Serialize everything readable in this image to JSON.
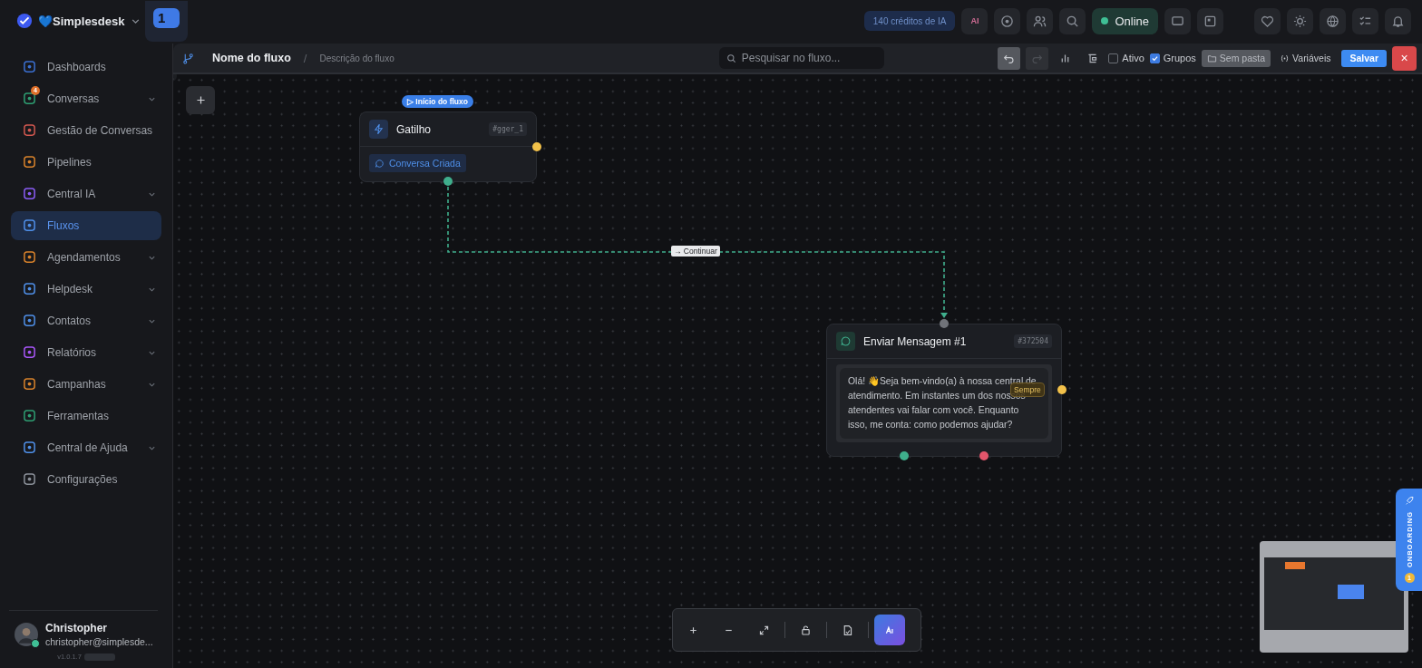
{
  "brand": {
    "name": "💙Simplesdesk"
  },
  "workspace": {
    "label": "1"
  },
  "topbar": {
    "credits": "140 créditos de IA",
    "ai": "AI",
    "status": "Online"
  },
  "sidebar": {
    "items": [
      {
        "label": "Dashboards",
        "color": "#3b6fd1",
        "expandable": false,
        "selected": false
      },
      {
        "label": "Conversas",
        "color": "#2e9e72",
        "expandable": true,
        "selected": false,
        "badge": "4"
      },
      {
        "label": "Gestão de Conversas",
        "color": "#d0574f",
        "expandable": false,
        "selected": false
      },
      {
        "label": "Pipelines",
        "color": "#d9822b",
        "expandable": false,
        "selected": false
      },
      {
        "label": "Central IA",
        "color": "#8b5cf6",
        "expandable": true,
        "selected": false
      },
      {
        "label": "Fluxos",
        "color": "#4f8fe8",
        "expandable": false,
        "selected": true
      },
      {
        "label": "Agendamentos",
        "color": "#d9822b",
        "expandable": true,
        "selected": false
      },
      {
        "label": "Helpdesk",
        "color": "#4f8fe8",
        "expandable": true,
        "selected": false
      },
      {
        "label": "Contatos",
        "color": "#4f8fe8",
        "expandable": true,
        "selected": false
      },
      {
        "label": "Relatórios",
        "color": "#a855f7",
        "expandable": true,
        "selected": false
      },
      {
        "label": "Campanhas",
        "color": "#d9822b",
        "expandable": true,
        "selected": false
      },
      {
        "label": "Ferramentas",
        "color": "#2e9e72",
        "expandable": false,
        "selected": false
      },
      {
        "label": "Central de Ajuda",
        "color": "#4f8fe8",
        "expandable": true,
        "selected": false
      },
      {
        "label": "Configurações",
        "color": "#8a8f98",
        "expandable": false,
        "selected": false
      }
    ]
  },
  "user": {
    "name": "Christopher",
    "email": "christopher@simplesde...",
    "online": true,
    "version": "v1.0.1.7"
  },
  "flow_toolbar": {
    "title": "Nome do fluxo",
    "separator": "/",
    "description": "Descrição do fluxo",
    "search": {
      "placeholder": "Pesquisar no fluxo..."
    },
    "undo_disabled": false,
    "redo_disabled": true,
    "checkboxes": [
      {
        "label": "Ativo",
        "checked": false
      },
      {
        "label": "Grupos",
        "checked": true
      }
    ],
    "folder": "Sem pasta",
    "variables": "Variáveis",
    "save": "Salvar",
    "close": "×"
  },
  "canvas": {
    "start_icon": "▷",
    "start_badge": "Início do fluxo",
    "trigger": {
      "title": "Gatilho",
      "id": "#gger_1",
      "event": "Conversa Criada"
    },
    "edge_arrow": "→",
    "edge_label": "Continuar",
    "message": {
      "title": "Enviar Mensagem #1",
      "id": "#372504",
      "text": "Olá! 👋Seja bem-vindo(a) à nossa central de atendimento. Em instantes um dos nossos atendentes vai falar com você. Enquanto isso, me conta: como podemos ajudar?",
      "tag": "Sempre"
    },
    "onboarding": {
      "label": "ONBOARDING",
      "count": "1"
    }
  }
}
